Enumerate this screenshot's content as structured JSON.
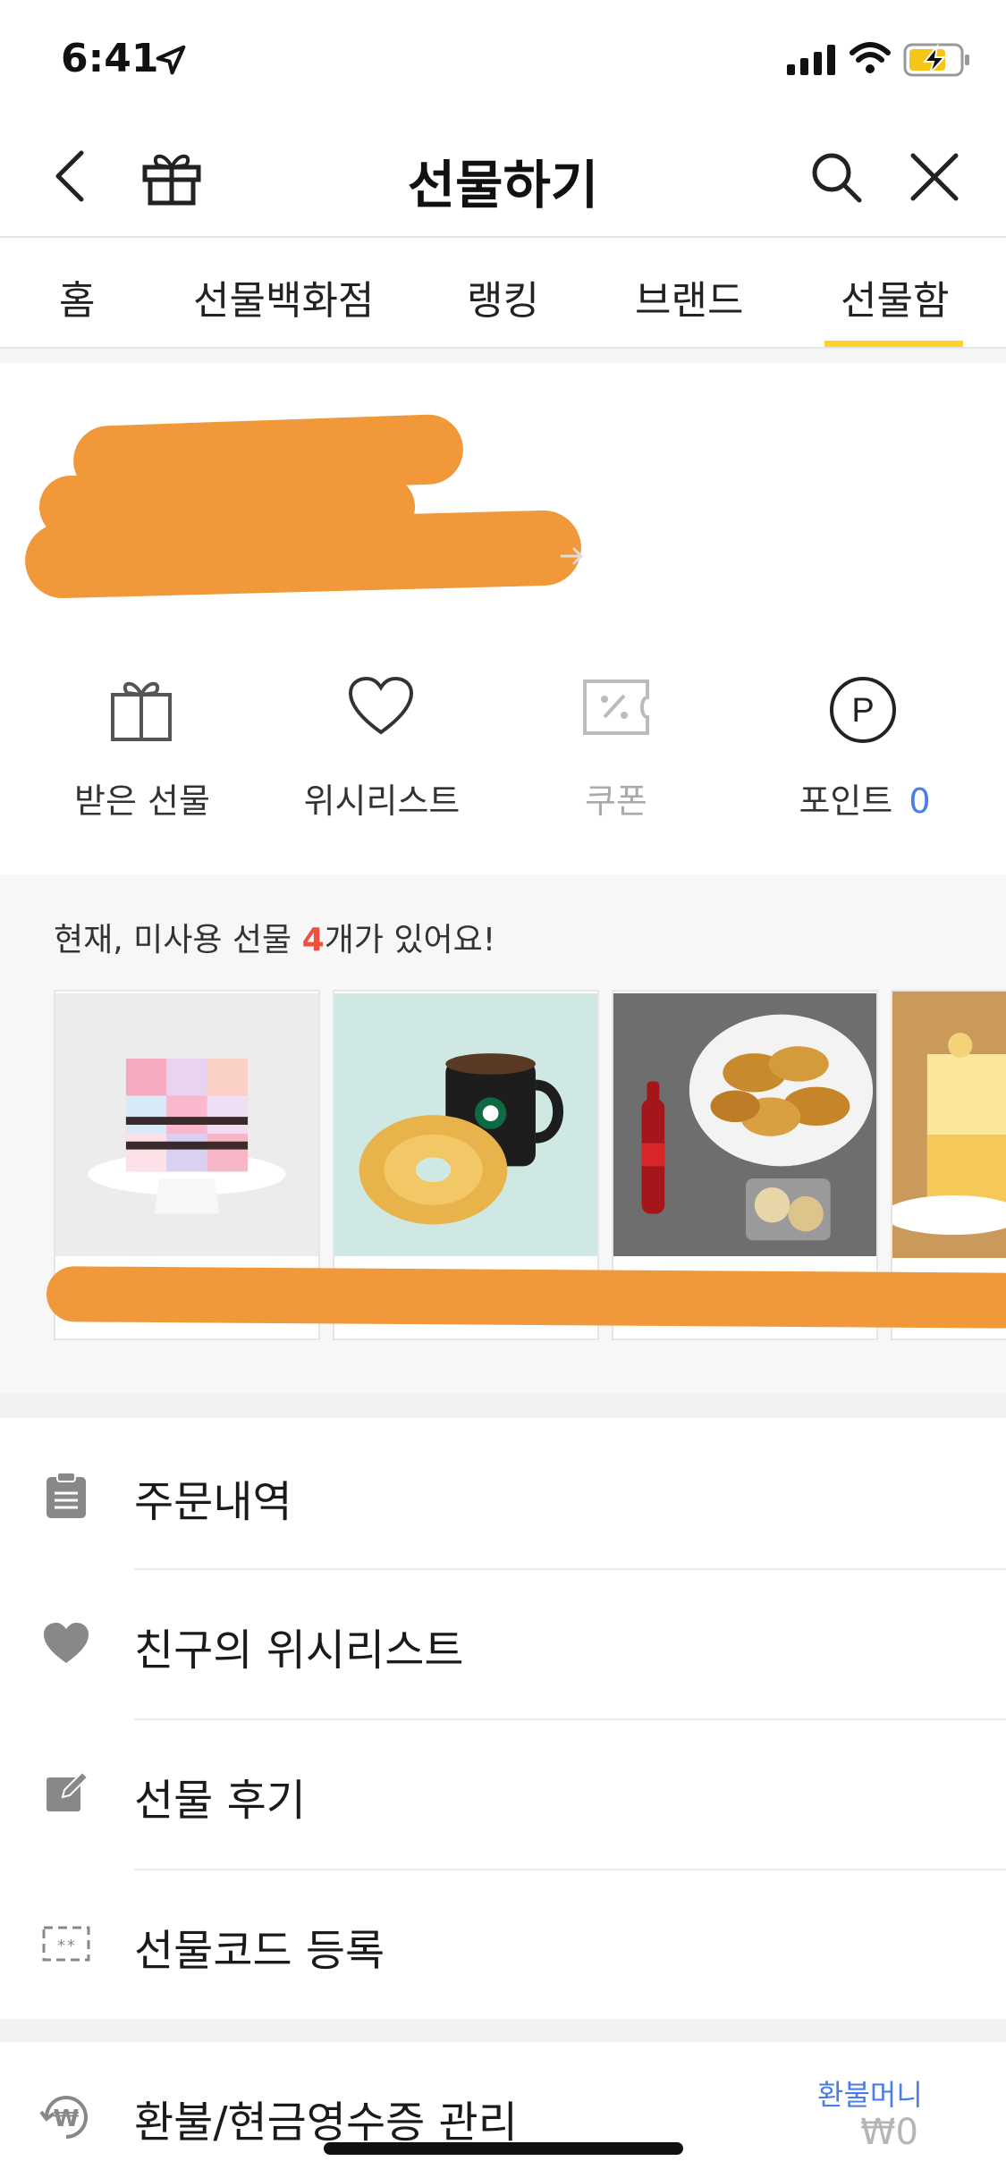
{
  "status": {
    "time": "6:41"
  },
  "header": {
    "title": "선물하기"
  },
  "tabs": [
    {
      "label": "홈"
    },
    {
      "label": "선물백화점"
    },
    {
      "label": "랭킹"
    },
    {
      "label": "브랜드"
    },
    {
      "label": "선물함",
      "active": true
    }
  ],
  "quick_actions": {
    "received": {
      "label": "받은 선물",
      "icon": "gift-icon"
    },
    "wishlist": {
      "label": "위시리스트",
      "icon": "heart-icon"
    },
    "coupon": {
      "label": "쿠폰",
      "icon": "coupon-icon"
    },
    "points": {
      "label": "포인트",
      "value": "0",
      "icon": "points-icon"
    }
  },
  "unused": {
    "prefix": "현재, 미사용 선물 ",
    "count": "4",
    "suffix": "개가 있어요!"
  },
  "menu": {
    "orders": "주문내역",
    "friend_wishlist": "친구의 위시리스트",
    "review": "선물 후기",
    "gift_code": "선물코드 등록",
    "refund": "환불/현금영수증 관리",
    "refund_money_label": "환불머니",
    "refund_money_value": "₩0"
  },
  "colors": {
    "accent_tab": "#fbd42b",
    "points": "#4a7de6",
    "unused_count": "#f04f3c",
    "redaction": "#f0983a"
  }
}
